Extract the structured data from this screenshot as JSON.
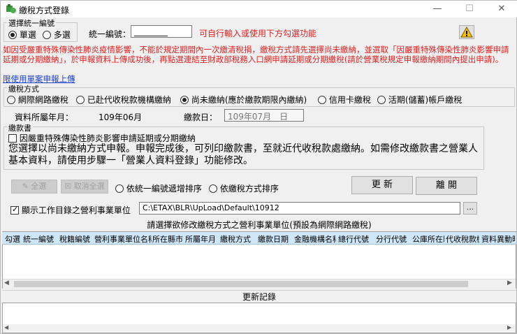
{
  "window": {
    "title": "繳稅方式登錄",
    "minimize": "—",
    "maximize": "☐",
    "close": "✕"
  },
  "selection_group": {
    "label": "選擇統一編號",
    "single": "單選",
    "multiple": "多選",
    "selected": "single"
  },
  "unified_number": {
    "label": "統一編號：",
    "value": "________",
    "hint": "可自行輸入或使用下方勾選功能"
  },
  "notice_text": "如因受嚴重特殊傳染性肺炎疫情影響，不能於規定期間內一次繳清稅捐，繳稅方式請先選擇尚未繳納，並選取「因嚴重特殊傳染性肺炎影響申請延期或分期繳納」，於申報資料上傳成功後，再點選連結至財政部稅務入口網申請延期或分期繳稅(請於營業稅規定申報繳納期間內提出申請)。",
  "notice_link": "限使用單案申報上傳",
  "payment_method": {
    "label": "繳稅方式",
    "options": [
      "網際網路繳稅",
      "已赴代收稅款機構繳納",
      "尚未繳納(應於繳款期限內繳納)",
      "信用卡繳稅",
      "活期(儲蓄)帳戶繳稅"
    ],
    "selected_index": 2
  },
  "period": {
    "label": "資料所屬年月：",
    "value": "109年06月"
  },
  "due_date": {
    "label": "繳款日：",
    "value": "109年07月　日"
  },
  "payment_slip": {
    "label": "繳款書",
    "checkbox_label": "因嚴重特殊傳染性肺炎影響申請延期或分期繳納",
    "checked": false,
    "message": "您選擇以尚未繳納方式申報。申報完成後，可列印繳款書，至就近代收稅款處繳納。如需修改繳款書之營業人基本資料，請使用步驟一「營業人資料登錄」功能修改。"
  },
  "actions": {
    "select_all": "全選",
    "deselect_all": "取消全選",
    "sort_by_id": "依統一編號遞增排序",
    "sort_by_method": "依繳稅方式排序",
    "sort_selected": "",
    "update": "更 新",
    "leave": "離 開"
  },
  "work_dir": {
    "checkbox_label": "顯示工作目錄之營利事業單位",
    "checked": true,
    "path": "C:\\ETAX\\BLR\\UpLoad\\Default\\10912",
    "browse": "..."
  },
  "grid": {
    "caption": "請選擇欲修改繳稅方式之營利事業單位(預設為網際網路繳稅)",
    "columns": [
      "勾選",
      "統一編號",
      "稅籍編號",
      "營利事業單位名稱",
      "所在縣市",
      "所屬年月",
      "繳稅方式",
      "繳款日期",
      "金融機構名稱",
      "總行代號",
      "分行代號",
      "公庫所在縣",
      "代收稅款機",
      "資料異動時"
    ]
  },
  "update_log": {
    "label": "更新記錄"
  },
  "colors": {
    "accent": "#e02020",
    "grid_header": "#cfe6f7",
    "link": "#1a3fcc"
  }
}
